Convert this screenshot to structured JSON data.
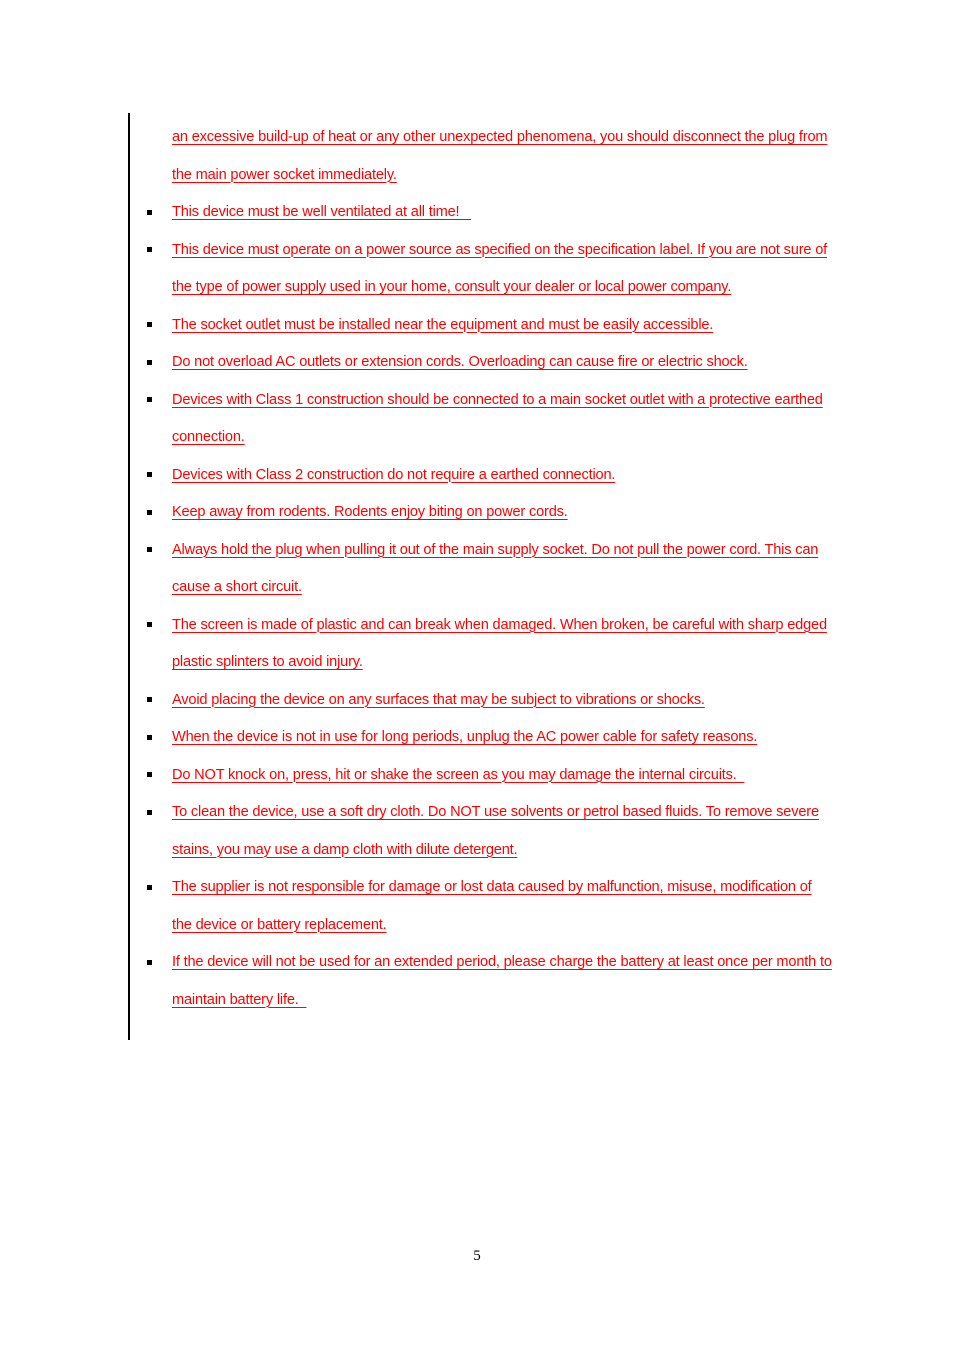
{
  "document": {
    "page_number": "5",
    "text_color": "#FF0000",
    "bullet_color": "#000000",
    "change_bar_color": "#000000"
  },
  "content": {
    "continuation_paragraph": {
      "has_bullet": false,
      "lines": [
        "an excessive build-up of heat or any other unexpected phenomena, you should disconnect the plug from",
        "the main power socket immediately."
      ]
    },
    "bullets": [
      {
        "lines": [
          "This device must be well ventilated at all time!   "
        ]
      },
      {
        "lines": [
          "This device must operate on a power source as specified on the specification label. If you are not sure of",
          "the type of power supply used in your home, consult your dealer or local power company."
        ]
      },
      {
        "lines": [
          "The socket outlet must be installed near the equipment and must be easily accessible."
        ]
      },
      {
        "lines": [
          "Do not overload AC outlets or extension cords. Overloading can cause fire or electric shock."
        ]
      },
      {
        "lines": [
          "Devices with Class 1 construction should be connected to a main socket outlet with a protective earthed",
          "connection."
        ]
      },
      {
        "lines": [
          "Devices with Class 2 construction do not require a earthed connection."
        ]
      },
      {
        "lines": [
          "Keep away from rodents. Rodents enjoy biting on power cords."
        ]
      },
      {
        "lines": [
          "Always hold the plug when pulling it out of the main supply socket. Do not pull the power cord. This can",
          "cause a short circuit."
        ]
      },
      {
        "lines": [
          "The screen is made of plastic and can break when damaged. When broken, be careful with sharp edged",
          "plastic splinters to avoid injury."
        ]
      },
      {
        "lines": [
          "Avoid placing the device on any surfaces that may be subject to vibrations or shocks."
        ]
      },
      {
        "lines": [
          "When the device is not in use for long periods, unplug the AC power cable for safety reasons."
        ]
      },
      {
        "lines": [
          "Do NOT knock on, press, hit or shake the screen as you may damage the internal circuits.  "
        ]
      },
      {
        "lines": [
          "To clean the device, use a soft dry cloth. Do NOT use solvents or petrol based fluids. To remove severe",
          "stains, you may use a damp cloth with dilute detergent."
        ]
      },
      {
        "lines": [
          "The supplier is not responsible for damage or lost data caused by malfunction, misuse, modification of",
          "the device or battery replacement."
        ]
      },
      {
        "lines": [
          "If the device will not be used for an extended period, please charge the battery at least once per month to",
          "maintain battery life.  "
        ]
      }
    ]
  }
}
